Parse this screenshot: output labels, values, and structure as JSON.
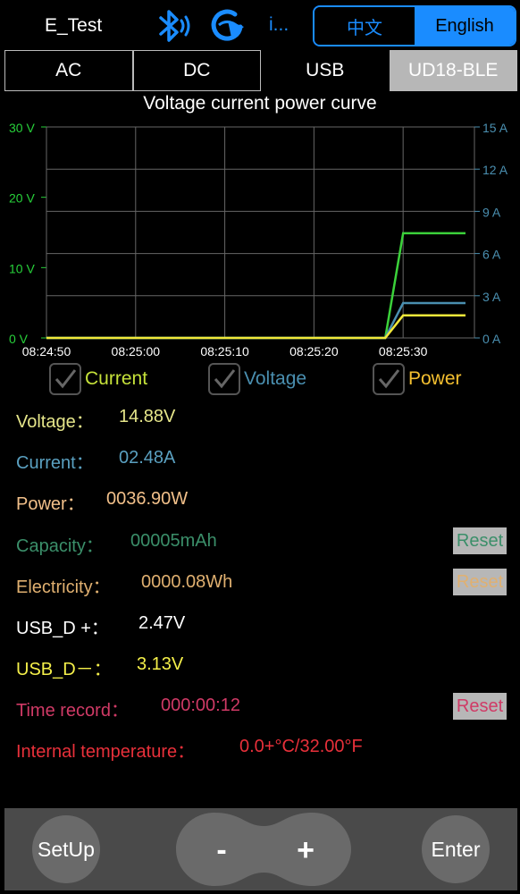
{
  "header": {
    "device_name": "E_Test",
    "more_label": "i...",
    "lang_cn": "中文",
    "lang_en": "English"
  },
  "tabs": [
    "AC",
    "DC",
    "USB",
    "UD18-BLE"
  ],
  "active_tab": "UD18-BLE",
  "chart_data": {
    "type": "line",
    "title": "Voltage current power curve",
    "x": [
      "08:24:50",
      "08:25:00",
      "08:25:10",
      "08:25:20",
      "08:25:30"
    ],
    "y_left": {
      "ticks": [
        "0 V",
        "10 V",
        "20 V",
        "30 V"
      ],
      "range": [
        0,
        30
      ],
      "unit": "V",
      "color": "#27d13a"
    },
    "y_right": {
      "ticks": [
        "0 A",
        "3 A",
        "6 A",
        "9 A",
        "12 A",
        "15 A"
      ],
      "range": [
        0,
        15
      ],
      "unit": "A",
      "color": "#4a8fb0"
    },
    "grid": true,
    "series": [
      {
        "name": "Voltage",
        "color": "#3bd13a",
        "axis": "left",
        "points": [
          [
            "08:24:50",
            0
          ],
          [
            "08:25:25",
            0
          ],
          [
            "08:25:28",
            0
          ],
          [
            "08:25:30",
            14.88
          ],
          [
            "08:25:37",
            14.88
          ]
        ]
      },
      {
        "name": "Current",
        "color": "#4a8fb0",
        "axis": "right",
        "points": [
          [
            "08:24:50",
            0
          ],
          [
            "08:25:28",
            0
          ],
          [
            "08:25:30",
            2.48
          ],
          [
            "08:25:37",
            2.48
          ]
        ]
      },
      {
        "name": "Power",
        "color": "#f2e83a",
        "axis": "left",
        "points": [
          [
            "08:24:50",
            0
          ],
          [
            "08:25:28",
            0
          ],
          [
            "08:25:30",
            3.2
          ],
          [
            "08:25:37",
            3.2
          ]
        ]
      }
    ]
  },
  "checkboxes": [
    {
      "label": "Current",
      "color": "#c6e23a",
      "checked": true
    },
    {
      "label": "Voltage",
      "color": "#4a8fb0",
      "checked": true
    },
    {
      "label": "Power",
      "color": "#f5c030",
      "checked": true
    }
  ],
  "readings": {
    "voltage": {
      "label": "Voltage：",
      "value": "14.88V",
      "color": "#e6e68a"
    },
    "current": {
      "label": "Current：",
      "value": "02.48A",
      "color": "#5aa0c0"
    },
    "power": {
      "label": "Power：",
      "value": "0036.90W",
      "color": "#f2c08a"
    },
    "capacity": {
      "label": "Capacity：",
      "value": "00005mAh",
      "color": "#3b8f6a"
    },
    "electricity": {
      "label": "Electricity：",
      "value": "0000.08Wh",
      "color": "#e0b070"
    },
    "usb_dp": {
      "label": "USB_D +：",
      "value": "2.47V",
      "color": "#ffffff"
    },
    "usb_dm": {
      "label": "USB_D－：",
      "value": "3.13V",
      "color": "#f5f04a"
    },
    "time_record": {
      "label": "Time record：",
      "value": "000:00:12",
      "color": "#d03a66"
    },
    "temperature": {
      "label": "Internal temperature：",
      "value": "0.0+°C/32.00°F",
      "color": "#e8303a"
    }
  },
  "reset_label": "Reset",
  "bottom": {
    "setup_label": "SetUp",
    "minus_label": "-",
    "plus_label": "+",
    "enter_label": "Enter"
  }
}
